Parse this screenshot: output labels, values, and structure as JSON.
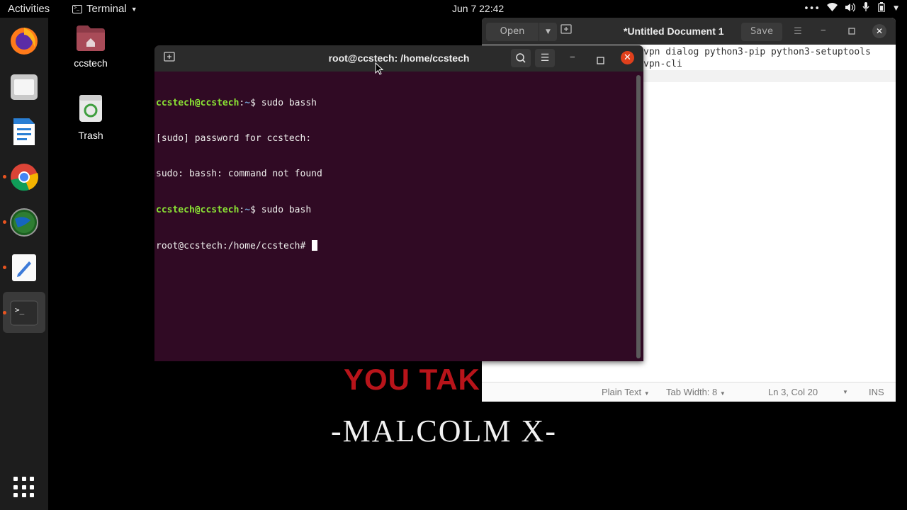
{
  "topbar": {
    "activities": "Activities",
    "app_name": "Terminal",
    "clock": "Jun 7  22:42"
  },
  "desktop": {
    "home_icon_label": "ccstech",
    "trash_icon_label": "Trash"
  },
  "wallpaper": {
    "red_text": "YOU TAK",
    "quote_author": "-MALCOLM X-"
  },
  "gedit": {
    "open_label": "Open",
    "title": "*Untitled Document 1",
    "save_label": "Save",
    "text_line1": "vpn dialog python3-pip python3-setuptools",
    "text_line2": "vpn-cli",
    "status_language": "Plain Text",
    "status_tab_width": "Tab Width: 8",
    "status_position": "Ln 3, Col 20",
    "status_mode": "INS"
  },
  "terminal": {
    "title": "root@ccstech: /home/ccstech",
    "lines": [
      {
        "user": "ccstech@ccstech",
        "path": "~",
        "cmd": "$ sudo bassh"
      },
      {
        "text": "[sudo] password for ccstech:"
      },
      {
        "text": "sudo: bassh: command not found"
      },
      {
        "user": "ccstech@ccstech",
        "path": "~",
        "cmd": "$ sudo bash"
      },
      {
        "text": "root@ccstech:/home/ccstech# "
      }
    ]
  },
  "colors": {
    "terminal_bg": "#300a24",
    "prompt_user": "#8ae234",
    "prompt_path": "#729fcf",
    "close_button": "#e0401c"
  }
}
